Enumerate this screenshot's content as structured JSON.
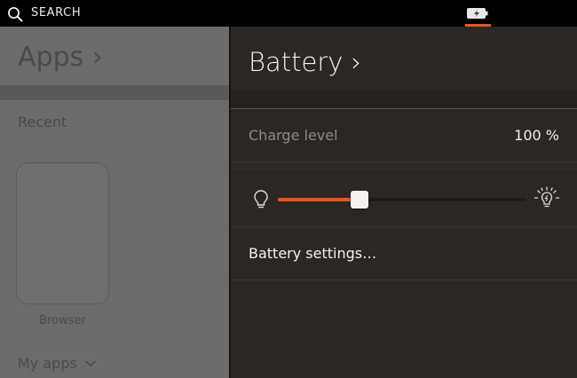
{
  "topbar": {
    "search_label": "SEARCH",
    "accent_color": "#e95420"
  },
  "apps_scope": {
    "title": "Apps",
    "title_chevron": "›",
    "recent_label": "Recent",
    "apps": [
      {
        "label": "Browser"
      }
    ],
    "my_apps_label": "My apps"
  },
  "battery": {
    "title": "Battery",
    "title_chevron": "›",
    "charge_label": "Charge level",
    "charge_value": "100 %",
    "brightness_level": 0.33,
    "settings_label": "Battery settings…"
  },
  "icons": {
    "search": "search-icon",
    "battery": "battery-charging-icon",
    "dim": "bulb-dim-icon",
    "bright": "bulb-bright-icon",
    "chevron": "chevron-down-icon"
  }
}
